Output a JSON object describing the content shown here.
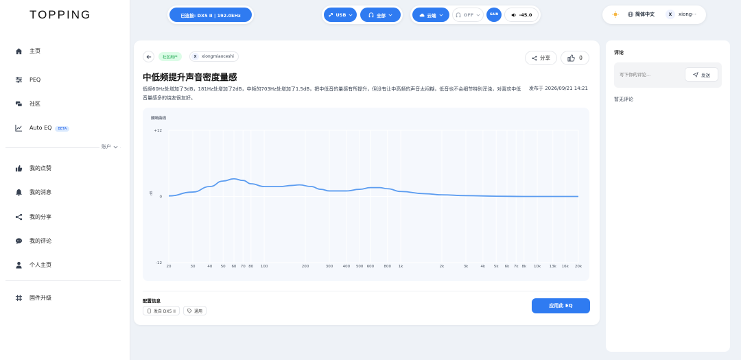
{
  "brand": {
    "logo": "TOPPING"
  },
  "sidebar": {
    "items": [
      {
        "label": "主页",
        "icon": "home-icon"
      },
      {
        "label": "PEQ",
        "icon": "equalizer-icon"
      },
      {
        "label": "社区",
        "icon": "community-icon"
      },
      {
        "label": "Auto EQ",
        "icon": "chart-icon",
        "badge": "BETA"
      }
    ],
    "account_label": "账户",
    "account_items": [
      {
        "label": "我的点赞",
        "icon": "thumbs-up-icon"
      },
      {
        "label": "我的消息",
        "icon": "bell-icon"
      },
      {
        "label": "我的分享",
        "icon": "share-icon"
      },
      {
        "label": "我的评论",
        "icon": "comment-icon"
      },
      {
        "label": "个人主页",
        "icon": "user-icon"
      }
    ],
    "firmware": {
      "label": "固件升级",
      "icon": "firmware-icon"
    }
  },
  "topbar": {
    "connection": "已连接: DX5 II | 192.0kHz",
    "usb": "USB",
    "all": "全部",
    "cloud": "云端",
    "off": "OFF",
    "gain": "GAIN",
    "volume": "-45.0",
    "language": "简体中文",
    "user_initial": "X",
    "username": "xiong···"
  },
  "post": {
    "community_badge": "社区用户",
    "author_initial": "X",
    "author": "xiongmiaoceshi",
    "share_label": "分享",
    "likes": "0",
    "title": "中低频提升声音密度量感",
    "description": "低频60Hz处增加了3dB，181Hz处增加了2dB，中频的703Hz处增加了1.5dB，把中低音的量感有所提升，但没有让中高频的声音太闷糊，低音也不会细节特别浑浊，对喜欢中低音量感多的烧友很友好。",
    "published": "发布于 2026/09/21 14:21",
    "config_title": "配置信息",
    "device_tag": "发自 DX5 II",
    "general_tag": "通用",
    "apply_button": "应用此 EQ"
  },
  "chart_data": {
    "type": "line",
    "title": "频响曲线",
    "xlabel": "",
    "ylabel": "dB",
    "x_scale": "log",
    "xlim": [
      20,
      20000
    ],
    "ylim": [
      -12,
      12
    ],
    "y_ticks": [
      "+12",
      "0",
      "-12"
    ],
    "x_ticks": [
      "20",
      "30",
      "40",
      "50",
      "60",
      "70",
      "80",
      "100",
      "200",
      "300",
      "400",
      "500",
      "600",
      "800",
      "1k",
      "2k",
      "3k",
      "4k",
      "5k",
      "6k",
      "7k",
      "8k",
      "10k",
      "13k",
      "16k",
      "20k"
    ],
    "x_tick_values": [
      20,
      30,
      40,
      50,
      60,
      70,
      80,
      100,
      200,
      300,
      400,
      500,
      600,
      800,
      1000,
      2000,
      3000,
      4000,
      5000,
      6000,
      7000,
      8000,
      10000,
      13000,
      16000,
      20000
    ],
    "series": [
      {
        "x": [
          20,
          30,
          40,
          50,
          60,
          70,
          80,
          100,
          130,
          160,
          181,
          220,
          260,
          300,
          400,
          500,
          600,
          703,
          800,
          1000,
          1500,
          2000,
          3000,
          5000,
          8000,
          12000,
          20000
        ],
        "y": [
          0.1,
          0.8,
          1.8,
          2.8,
          3.2,
          2.9,
          2.3,
          1.8,
          1.8,
          2.0,
          2.1,
          1.8,
          1.3,
          1.0,
          1.0,
          1.3,
          1.6,
          1.6,
          1.4,
          0.9,
          0.5,
          0.3,
          0.15,
          0.05,
          0.0,
          0.0,
          0.0
        ],
        "color": "#5b9cf0"
      }
    ]
  },
  "comments": {
    "title": "评论",
    "placeholder": "写下你的评论...",
    "send_label": "发送",
    "empty": "暂无评论"
  },
  "colors": {
    "accent": "#2f7bf1",
    "community_badge_bg": "#dcfce7",
    "community_badge_fg": "#16a34a"
  }
}
